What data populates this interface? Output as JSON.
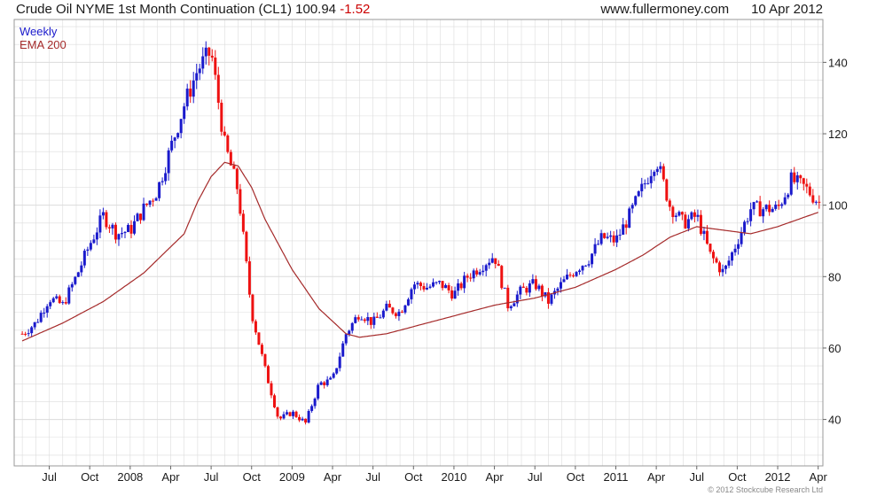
{
  "header": {
    "instrument": "Crude Oil NYME 1st Month Continuation (CL1)",
    "price": "100.94",
    "change": "-1.52",
    "site": "www.fullermoney.com",
    "date": "10 Apr 2012"
  },
  "legend": {
    "frequency": "Weekly",
    "indicator": "EMA 200"
  },
  "footer": {
    "copyright": "© 2012 Stockcube Research Ltd"
  },
  "colors": {
    "up": "#1a1acc",
    "down": "#ee1111",
    "ema": "#a52a2a",
    "grid": "#dcdcdc",
    "frame": "#999999"
  },
  "chart_data": {
    "type": "candlestick",
    "grid": true,
    "legend_position": "top-left",
    "ylim": [
      27,
      152
    ],
    "y_ticks": [
      40,
      60,
      80,
      100,
      120,
      140
    ],
    "y_axis_side": "right",
    "x_axis": {
      "start": "2007-05",
      "end": "2012-04",
      "ticks": [
        {
          "label": "Jul",
          "t": "2007-07"
        },
        {
          "label": "Oct",
          "t": "2007-10"
        },
        {
          "label": "2008",
          "t": "2008-01"
        },
        {
          "label": "Apr",
          "t": "2008-04"
        },
        {
          "label": "Jul",
          "t": "2008-07"
        },
        {
          "label": "Oct",
          "t": "2008-10"
        },
        {
          "label": "2009",
          "t": "2009-01"
        },
        {
          "label": "Apr",
          "t": "2009-04"
        },
        {
          "label": "Jul",
          "t": "2009-07"
        },
        {
          "label": "Oct",
          "t": "2009-10"
        },
        {
          "label": "2010",
          "t": "2010-01"
        },
        {
          "label": "Apr",
          "t": "2010-04"
        },
        {
          "label": "Jul",
          "t": "2010-07"
        },
        {
          "label": "Oct",
          "t": "2010-10"
        },
        {
          "label": "2011",
          "t": "2011-01"
        },
        {
          "label": "Apr",
          "t": "2011-04"
        },
        {
          "label": "Jul",
          "t": "2011-07"
        },
        {
          "label": "Oct",
          "t": "2011-10"
        },
        {
          "label": "2012",
          "t": "2012-01"
        },
        {
          "label": "Apr",
          "t": "2012-04"
        }
      ]
    },
    "price_path": [
      [
        "2007-05",
        64
      ],
      [
        "2007-06",
        67
      ],
      [
        "2007-07",
        74
      ],
      [
        "2007-08",
        72
      ],
      [
        "2007-09",
        80
      ],
      [
        "2007-10",
        89
      ],
      [
        "2007-11",
        97
      ],
      [
        "2007-12",
        92
      ],
      [
        "2008-01",
        93
      ],
      [
        "2008-02",
        99
      ],
      [
        "2008-03",
        104
      ],
      [
        "2008-04",
        116
      ],
      [
        "2008-05",
        128
      ],
      [
        "2008-06",
        138
      ],
      [
        "2008-07",
        143
      ],
      [
        "2008-08",
        117
      ],
      [
        "2008-09",
        104
      ],
      [
        "2008-10",
        70
      ],
      [
        "2008-11",
        54
      ],
      [
        "2008-12",
        40
      ],
      [
        "2009-01",
        42
      ],
      [
        "2009-02",
        39
      ],
      [
        "2009-03",
        50
      ],
      [
        "2009-04",
        51
      ],
      [
        "2009-05",
        64
      ],
      [
        "2009-06",
        70
      ],
      [
        "2009-07",
        67
      ],
      [
        "2009-08",
        71
      ],
      [
        "2009-09",
        70
      ],
      [
        "2009-10",
        78
      ],
      [
        "2009-11",
        77
      ],
      [
        "2009-12",
        78
      ],
      [
        "2010-01",
        75
      ],
      [
        "2010-02",
        80
      ],
      [
        "2010-03",
        83
      ],
      [
        "2010-04",
        86
      ],
      [
        "2010-05",
        72
      ],
      [
        "2010-06",
        76
      ],
      [
        "2010-07",
        78
      ],
      [
        "2010-08",
        73
      ],
      [
        "2010-09",
        78
      ],
      [
        "2010-10",
        82
      ],
      [
        "2010-11",
        85
      ],
      [
        "2010-12",
        91
      ],
      [
        "2011-01",
        90
      ],
      [
        "2011-02",
        97
      ],
      [
        "2011-03",
        105
      ],
      [
        "2011-04",
        113
      ],
      [
        "2011-05",
        100
      ],
      [
        "2011-06",
        95
      ],
      [
        "2011-07",
        97
      ],
      [
        "2011-08",
        86
      ],
      [
        "2011-09",
        81
      ],
      [
        "2011-10",
        90
      ],
      [
        "2011-11",
        99
      ],
      [
        "2011-12",
        99
      ],
      [
        "2012-01",
        99
      ],
      [
        "2012-02",
        107
      ],
      [
        "2012-03",
        105
      ],
      [
        "2012-04",
        101
      ]
    ],
    "ema_path": [
      [
        "2007-05",
        62
      ],
      [
        "2007-08",
        67
      ],
      [
        "2007-11",
        73
      ],
      [
        "2008-02",
        81
      ],
      [
        "2008-05",
        92
      ],
      [
        "2008-06",
        101
      ],
      [
        "2008-07",
        108
      ],
      [
        "2008-08",
        112
      ],
      [
        "2008-09",
        111
      ],
      [
        "2008-10",
        105
      ],
      [
        "2008-11",
        96
      ],
      [
        "2009-01",
        82
      ],
      [
        "2009-03",
        71
      ],
      [
        "2009-05",
        64
      ],
      [
        "2009-06",
        63
      ],
      [
        "2009-08",
        64
      ],
      [
        "2009-10",
        66
      ],
      [
        "2010-01",
        69
      ],
      [
        "2010-04",
        72
      ],
      [
        "2010-07",
        74
      ],
      [
        "2010-10",
        77
      ],
      [
        "2011-01",
        82
      ],
      [
        "2011-03",
        86
      ],
      [
        "2011-05",
        91
      ],
      [
        "2011-07",
        94
      ],
      [
        "2011-09",
        93
      ],
      [
        "2011-11",
        92
      ],
      [
        "2012-01",
        94
      ],
      [
        "2012-04",
        98
      ]
    ],
    "last_close": 100.94
  }
}
